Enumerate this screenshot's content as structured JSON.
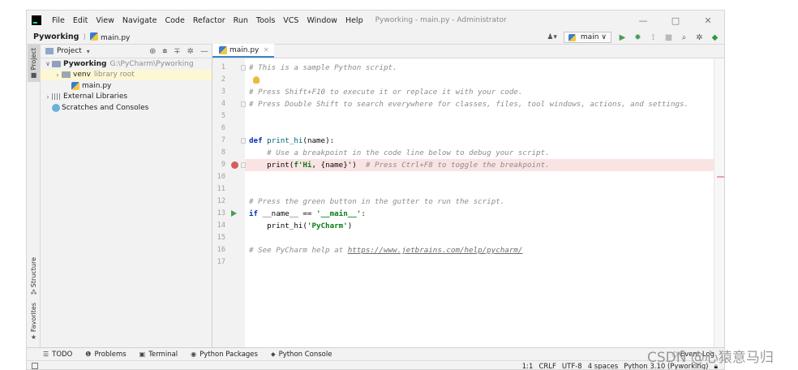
{
  "menubar": {
    "items": [
      "File",
      "Edit",
      "View",
      "Navigate",
      "Code",
      "Refactor",
      "Run",
      "Tools",
      "VCS",
      "Window",
      "Help"
    ],
    "window_title": "Pyworking - main.py - Administrator",
    "minimize": "—",
    "maximize": "□",
    "close": "✕"
  },
  "navbar": {
    "project": "Pyworking",
    "separator": "⟩",
    "file": "main.py",
    "run_config": "main",
    "vcs_user": "♟▾"
  },
  "left_strip": {
    "project": "Project",
    "structure": "Structure",
    "favorites": "Favorites"
  },
  "project_panel": {
    "title": "Project",
    "dropdown": "▾",
    "tree": [
      {
        "arrow": "∨",
        "name": "Pyworking",
        "hint": "G:\\PyCharm\\Pyworking",
        "type": "root",
        "indent": 0
      },
      {
        "arrow": "›",
        "name": "venv",
        "hint": "library root",
        "type": "folder",
        "indent": 1
      },
      {
        "arrow": "",
        "name": "main.py",
        "hint": "",
        "type": "py",
        "indent": 2
      },
      {
        "arrow": "›",
        "name": "External Libraries",
        "hint": "",
        "type": "lib",
        "indent": 0
      },
      {
        "arrow": "",
        "name": "Scratches and Consoles",
        "hint": "",
        "type": "scratch",
        "indent": 0
      }
    ]
  },
  "editor": {
    "tab_label": "main.py",
    "tab_close": "×",
    "lines": [
      {
        "n": "1",
        "html": "<span class='cm'># This is a sample Python script.</span>"
      },
      {
        "n": "2",
        "html": ""
      },
      {
        "n": "3",
        "html": "<span class='cm'># Press Shift+F10 to execute it or replace it with your code.</span>"
      },
      {
        "n": "4",
        "html": "<span class='cm'># Press Double Shift to search everywhere for classes, files, tool windows, actions, and settings.</span>"
      },
      {
        "n": "5",
        "html": ""
      },
      {
        "n": "6",
        "html": ""
      },
      {
        "n": "7",
        "html": "<span class='kw'>def</span> <span class='fn'>print_hi</span>(name):"
      },
      {
        "n": "8",
        "html": "    <span class='cm'># Use a breakpoint in the code line below to debug your script.</span>"
      },
      {
        "n": "9",
        "html": "    print(<span class='str'>f'Hi, </span>{name}<span class='str'>'</span>)  <span class='cm'># Press Ctrl+F8 to toggle the breakpoint.</span>"
      },
      {
        "n": "10",
        "html": ""
      },
      {
        "n": "11",
        "html": ""
      },
      {
        "n": "12",
        "html": "<span class='cm'># Press the green button in the gutter to run the script.</span>"
      },
      {
        "n": "13",
        "html": "<span class='kw'>if</span> __name__ == <span class='str'>'__main__'</span>:"
      },
      {
        "n": "14",
        "html": "    print_hi(<span class='str'>'PyCharm'</span>)"
      },
      {
        "n": "15",
        "html": ""
      },
      {
        "n": "16",
        "html": "<span class='cm'># See PyCharm help at </span><span class='link'>https://www.jetbrains.com/help/pycharm/</span>"
      },
      {
        "n": "17",
        "html": ""
      }
    ]
  },
  "bottom_tools": [
    {
      "icon": "☰",
      "label": "TODO"
    },
    {
      "icon": "❶",
      "label": "Problems"
    },
    {
      "icon": "▣",
      "label": "Terminal"
    },
    {
      "icon": "◉",
      "label": "Python Packages"
    },
    {
      "icon": "⬥",
      "label": "Python Console"
    }
  ],
  "event_log": "Event Log",
  "status": {
    "position": "1:1",
    "line_sep": "CRLF",
    "encoding": "UTF-8",
    "indent": "4 spaces",
    "interpreter": "Python 3.10 (Pyworking)"
  },
  "watermark": "CSDN @心猿意马归",
  "colors": {
    "breakpoint": "#db5860",
    "run_arrow": "#499c54",
    "accent": "#4083c9"
  }
}
